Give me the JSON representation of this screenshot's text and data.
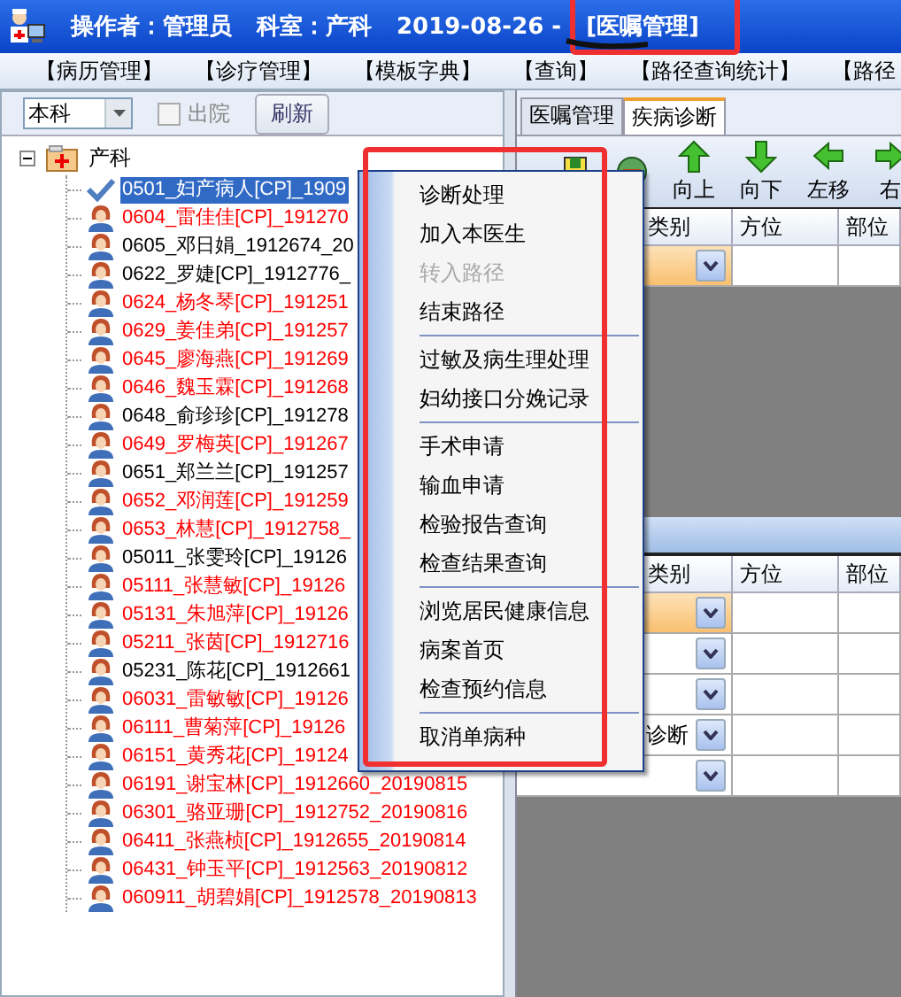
{
  "title_bar": {
    "operator": "操作者：管理员",
    "department": "科室：产科",
    "date": "2019-08-26 -",
    "module": "[医嘱管理]"
  },
  "menu_bar": [
    "【病历管理】",
    "【诊疗管理】",
    "【模板字典】",
    "【查询】",
    "【路径查询统计】",
    "【路径"
  ],
  "left_panel": {
    "scope_select": {
      "value": "本科"
    },
    "discharged": {
      "label": "出院",
      "checked": false
    },
    "refresh_button": "刷新",
    "tree": {
      "label": "产科",
      "expanded": true,
      "children": [
        {
          "label": "0501_妇产病人[CP]_1909",
          "selected": true
        },
        {
          "label": "0604_雷佳佳[CP]_191270",
          "color": "#ff0000",
          "selected": false
        },
        {
          "label": "0605_邓日娟_1912674_20",
          "color": "#000000",
          "selected": false
        },
        {
          "label": "0622_罗婕[CP]_1912776_",
          "color": "#000000",
          "selected": false
        },
        {
          "label": "0624_杨冬琴[CP]_191251",
          "color": "#ff0000",
          "selected": false
        },
        {
          "label": "0629_姜佳弟[CP]_191257",
          "color": "#ff0000",
          "selected": false
        },
        {
          "label": "0645_廖海燕[CP]_191269",
          "color": "#ff0000",
          "selected": false
        },
        {
          "label": "0646_魏玉霖[CP]_191268",
          "color": "#ff0000",
          "selected": false
        },
        {
          "label": "0648_俞珍珍[CP]_191278",
          "color": "#000000",
          "selected": false
        },
        {
          "label": "0649_罗梅英[CP]_191267",
          "color": "#ff0000",
          "selected": false
        },
        {
          "label": "0651_郑兰兰[CP]_191257",
          "color": "#000000",
          "selected": false
        },
        {
          "label": "0652_邓润莲[CP]_191259",
          "color": "#ff0000",
          "selected": false
        },
        {
          "label": "0653_林慧[CP]_1912758_",
          "color": "#ff0000",
          "selected": false
        },
        {
          "label": "05011_张雯玲[CP]_19126",
          "color": "#000000",
          "selected": false
        },
        {
          "label": "05111_张慧敏[CP]_19126",
          "color": "#ff0000",
          "selected": false
        },
        {
          "label": "05131_朱旭萍[CP]_19126",
          "color": "#ff0000",
          "selected": false
        },
        {
          "label": "05211_张茵[CP]_1912716",
          "color": "#ff0000",
          "selected": false
        },
        {
          "label": "05231_陈花[CP]_1912661",
          "color": "#000000",
          "selected": false
        },
        {
          "label": "06031_雷敏敏[CP]_19126",
          "color": "#ff0000",
          "selected": false
        },
        {
          "label": "06111_曹菊萍[CP]_19126",
          "color": "#ff0000",
          "selected": false
        },
        {
          "label": "06151_黄秀花[CP]_19124",
          "color": "#ff0000",
          "selected": false
        },
        {
          "label": "06191_谢宝林[CP]_1912660_20190815",
          "color": "#ff0000",
          "selected": false
        },
        {
          "label": "06301_骆亚珊[CP]_1912752_20190816",
          "color": "#ff0000",
          "selected": false
        },
        {
          "label": "06411_张燕桢[CP]_1912655_20190814",
          "color": "#ff0000",
          "selected": false
        },
        {
          "label": "06431_钟玉平[CP]_1912563_20190812",
          "color": "#ff0000",
          "selected": false
        },
        {
          "label": "060911_胡碧娟[CP]_1912578_20190813",
          "color": "#ff0000",
          "selected": false
        }
      ]
    }
  },
  "right_panel": {
    "tabs": [
      {
        "label": "医嘱管理",
        "selected": false
      },
      {
        "label": "疾病诊断",
        "selected": true
      }
    ],
    "toolbar": [
      {
        "kind": "save"
      },
      {
        "kind": "delete"
      },
      {
        "kind": "up",
        "label": "向上"
      },
      {
        "kind": "down",
        "label": "向下"
      },
      {
        "kind": "left",
        "label": "左移"
      },
      {
        "kind": "right",
        "label": "右"
      }
    ],
    "grid_top": {
      "columns": [
        "类别",
        "方位",
        "部位"
      ],
      "rows": [
        {
          "selected": true
        }
      ]
    },
    "grid_bottom": {
      "columns": [
        "类别",
        "方位",
        "部位"
      ],
      "rows": [
        {
          "selected": true
        },
        {
          "selected": false
        },
        {
          "selected": false
        },
        {
          "text": "诊断",
          "selected": false
        },
        {
          "selected": false
        }
      ]
    }
  },
  "context_menu": {
    "groups": [
      [
        {
          "label": "诊断处理",
          "disabled": false
        },
        {
          "label": "加入本医生",
          "disabled": false
        },
        {
          "label": "转入路径",
          "disabled": true
        },
        {
          "label": "结束路径",
          "disabled": false
        }
      ],
      [
        {
          "label": "过敏及病生理处理",
          "disabled": false
        },
        {
          "label": "妇幼接口分娩记录",
          "disabled": false
        }
      ],
      [
        {
          "label": "手术申请",
          "disabled": false
        },
        {
          "label": "输血申请",
          "disabled": false
        },
        {
          "label": "检验报告查询",
          "disabled": false
        },
        {
          "label": "检查结果查询",
          "disabled": false
        }
      ],
      [
        {
          "label": "浏览居民健康信息",
          "disabled": false
        },
        {
          "label": "病案首页",
          "disabled": false
        },
        {
          "label": "检查预约信息",
          "disabled": false
        }
      ],
      [
        {
          "label": "取消单病种",
          "disabled": false
        }
      ]
    ]
  }
}
